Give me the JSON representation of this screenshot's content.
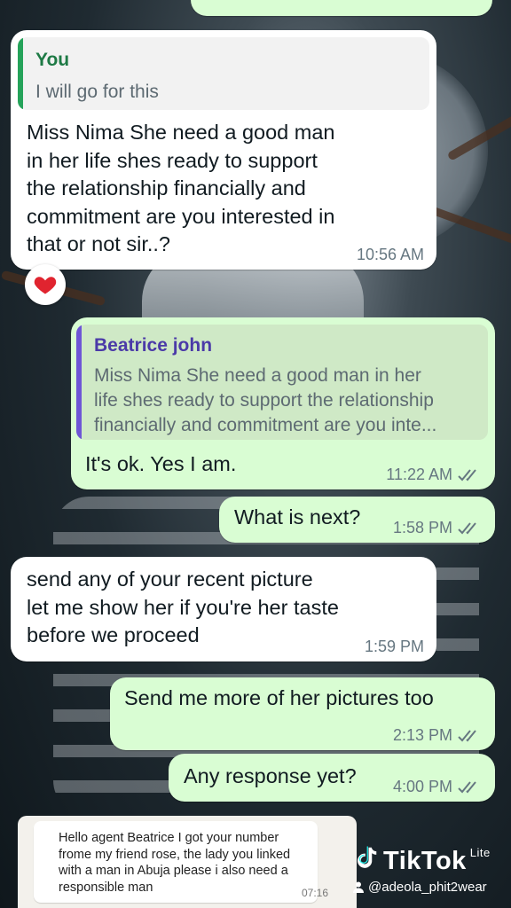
{
  "chat": {
    "msg1": {
      "quote_author": "You",
      "quote_text": "I will go for this",
      "text": "Miss Nima She need a good man\nin her life shes ready to support\nthe relationship  financially and\ncommitment are you interested in\nthat or not sir..?",
      "time": "10:56 AM",
      "reaction": "heart"
    },
    "msg2": {
      "quote_author": "Beatrice john",
      "quote_text": "Miss Nima She need a good man in her\nlife shes ready to support the relationship\nfinancially and commitment are you inte...",
      "text": "It's ok. Yes I am.",
      "time": "11:22 AM"
    },
    "msg3": {
      "text": "What is next?",
      "time": "1:58 PM"
    },
    "msg4": {
      "text": "send any of your recent picture\nlet me show her if you're her taste\nbefore we proceed",
      "time": "1:59 PM"
    },
    "msg5": {
      "text": "Send me more of her pictures too",
      "time": "2:13 PM"
    },
    "msg6": {
      "text": "Any response yet?",
      "time": "4:00 PM"
    },
    "embedded": {
      "text": "Hello agent Beatrice I got your number\nfrome my friend rose, the lady you linked\nwith a man in Abuja please i also need a\nresponsible man",
      "time": "07:16"
    }
  },
  "watermark": {
    "brand": "TikTok",
    "suffix": "Lite",
    "handle": "@adeola_phit2wear"
  },
  "colors": {
    "incoming_bubble": "#ffffff",
    "outgoing_bubble": "#d9fdd3",
    "quote_you_bar": "#25a35a",
    "quote_you_author": "#1e7a45",
    "quote_beatrice_bar": "#6e55d6",
    "quote_beatrice_author": "#4b3aa8",
    "read_ticks": "#667781"
  },
  "icons": [
    "heart-icon",
    "double-check-icon",
    "tiktok-note-icon",
    "user-icon"
  ]
}
